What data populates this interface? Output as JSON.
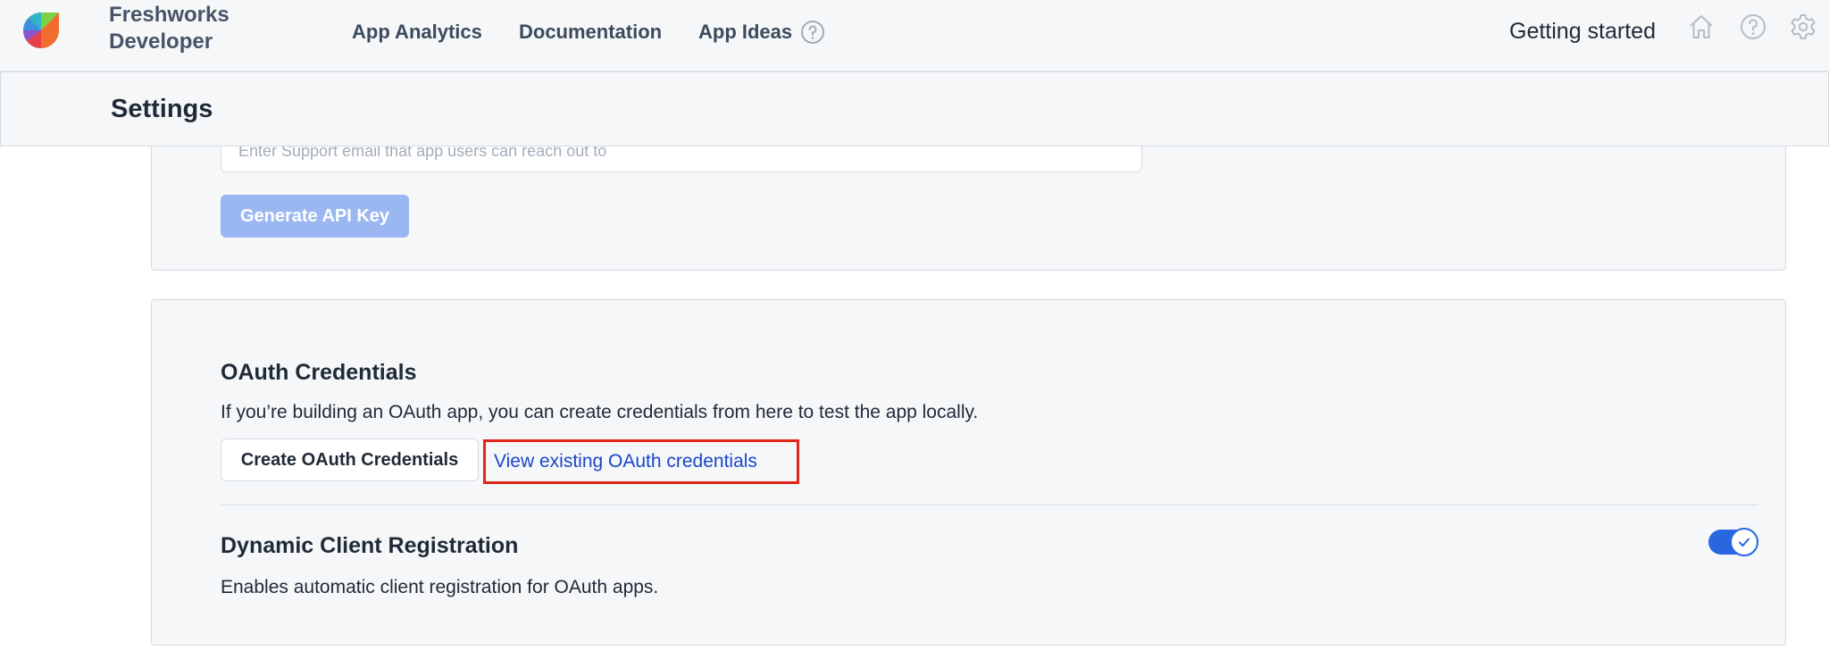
{
  "brand": {
    "line1": "Freshworks",
    "line2": "Developer"
  },
  "nav": {
    "analytics": "App Analytics",
    "documentation": "Documentation",
    "ideas": "App Ideas",
    "getting_started": "Getting started"
  },
  "icons": {
    "logo": "freshworks-logo-icon",
    "ideas_help": "help-circle-icon",
    "home": "home-icon",
    "help": "help-circle-icon",
    "settings": "gear-icon",
    "toggle_check": "check-icon"
  },
  "settings": {
    "title": "Settings"
  },
  "api_card": {
    "email_placeholder": "Enter Support email that app users can reach out to",
    "email_value": "",
    "generate_button": "Generate API Key"
  },
  "oauth_card": {
    "title": "OAuth Credentials",
    "description": "If you’re building an OAuth app, you can create credentials from here to test the app locally.",
    "create_button": "Create OAuth Credentials",
    "view_link": "View existing OAuth credentials",
    "dcr_title": "Dynamic Client Registration",
    "dcr_description": "Enables automatic client registration for OAuth apps.",
    "dcr_enabled": true
  },
  "colors": {
    "accent": "#2867e0",
    "link": "#1a46c8",
    "highlight_border": "#e1251b",
    "disabled_button": "#9bb7f2"
  }
}
